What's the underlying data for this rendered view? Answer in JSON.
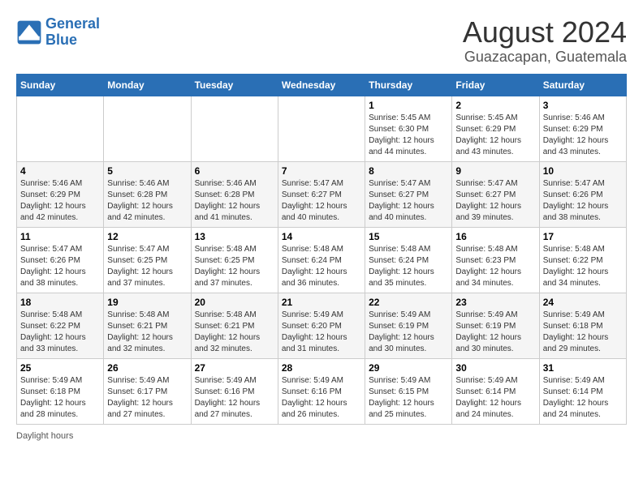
{
  "header": {
    "logo_line1": "General",
    "logo_line2": "Blue",
    "title": "August 2024",
    "subtitle": "Guazacapan, Guatemala"
  },
  "days_of_week": [
    "Sunday",
    "Monday",
    "Tuesday",
    "Wednesday",
    "Thursday",
    "Friday",
    "Saturday"
  ],
  "weeks": [
    [
      {
        "day": "",
        "sunrise": "",
        "sunset": "",
        "daylight": ""
      },
      {
        "day": "",
        "sunrise": "",
        "sunset": "",
        "daylight": ""
      },
      {
        "day": "",
        "sunrise": "",
        "sunset": "",
        "daylight": ""
      },
      {
        "day": "",
        "sunrise": "",
        "sunset": "",
        "daylight": ""
      },
      {
        "day": "1",
        "sunrise": "5:45 AM",
        "sunset": "6:30 PM",
        "daylight": "12 hours and 44 minutes."
      },
      {
        "day": "2",
        "sunrise": "5:45 AM",
        "sunset": "6:29 PM",
        "daylight": "12 hours and 43 minutes."
      },
      {
        "day": "3",
        "sunrise": "5:46 AM",
        "sunset": "6:29 PM",
        "daylight": "12 hours and 43 minutes."
      }
    ],
    [
      {
        "day": "4",
        "sunrise": "5:46 AM",
        "sunset": "6:29 PM",
        "daylight": "12 hours and 42 minutes."
      },
      {
        "day": "5",
        "sunrise": "5:46 AM",
        "sunset": "6:28 PM",
        "daylight": "12 hours and 42 minutes."
      },
      {
        "day": "6",
        "sunrise": "5:46 AM",
        "sunset": "6:28 PM",
        "daylight": "12 hours and 41 minutes."
      },
      {
        "day": "7",
        "sunrise": "5:47 AM",
        "sunset": "6:27 PM",
        "daylight": "12 hours and 40 minutes."
      },
      {
        "day": "8",
        "sunrise": "5:47 AM",
        "sunset": "6:27 PM",
        "daylight": "12 hours and 40 minutes."
      },
      {
        "day": "9",
        "sunrise": "5:47 AM",
        "sunset": "6:27 PM",
        "daylight": "12 hours and 39 minutes."
      },
      {
        "day": "10",
        "sunrise": "5:47 AM",
        "sunset": "6:26 PM",
        "daylight": "12 hours and 38 minutes."
      }
    ],
    [
      {
        "day": "11",
        "sunrise": "5:47 AM",
        "sunset": "6:26 PM",
        "daylight": "12 hours and 38 minutes."
      },
      {
        "day": "12",
        "sunrise": "5:47 AM",
        "sunset": "6:25 PM",
        "daylight": "12 hours and 37 minutes."
      },
      {
        "day": "13",
        "sunrise": "5:48 AM",
        "sunset": "6:25 PM",
        "daylight": "12 hours and 37 minutes."
      },
      {
        "day": "14",
        "sunrise": "5:48 AM",
        "sunset": "6:24 PM",
        "daylight": "12 hours and 36 minutes."
      },
      {
        "day": "15",
        "sunrise": "5:48 AM",
        "sunset": "6:24 PM",
        "daylight": "12 hours and 35 minutes."
      },
      {
        "day": "16",
        "sunrise": "5:48 AM",
        "sunset": "6:23 PM",
        "daylight": "12 hours and 34 minutes."
      },
      {
        "day": "17",
        "sunrise": "5:48 AM",
        "sunset": "6:22 PM",
        "daylight": "12 hours and 34 minutes."
      }
    ],
    [
      {
        "day": "18",
        "sunrise": "5:48 AM",
        "sunset": "6:22 PM",
        "daylight": "12 hours and 33 minutes."
      },
      {
        "day": "19",
        "sunrise": "5:48 AM",
        "sunset": "6:21 PM",
        "daylight": "12 hours and 32 minutes."
      },
      {
        "day": "20",
        "sunrise": "5:48 AM",
        "sunset": "6:21 PM",
        "daylight": "12 hours and 32 minutes."
      },
      {
        "day": "21",
        "sunrise": "5:49 AM",
        "sunset": "6:20 PM",
        "daylight": "12 hours and 31 minutes."
      },
      {
        "day": "22",
        "sunrise": "5:49 AM",
        "sunset": "6:19 PM",
        "daylight": "12 hours and 30 minutes."
      },
      {
        "day": "23",
        "sunrise": "5:49 AM",
        "sunset": "6:19 PM",
        "daylight": "12 hours and 30 minutes."
      },
      {
        "day": "24",
        "sunrise": "5:49 AM",
        "sunset": "6:18 PM",
        "daylight": "12 hours and 29 minutes."
      }
    ],
    [
      {
        "day": "25",
        "sunrise": "5:49 AM",
        "sunset": "6:18 PM",
        "daylight": "12 hours and 28 minutes."
      },
      {
        "day": "26",
        "sunrise": "5:49 AM",
        "sunset": "6:17 PM",
        "daylight": "12 hours and 27 minutes."
      },
      {
        "day": "27",
        "sunrise": "5:49 AM",
        "sunset": "6:16 PM",
        "daylight": "12 hours and 27 minutes."
      },
      {
        "day": "28",
        "sunrise": "5:49 AM",
        "sunset": "6:16 PM",
        "daylight": "12 hours and 26 minutes."
      },
      {
        "day": "29",
        "sunrise": "5:49 AM",
        "sunset": "6:15 PM",
        "daylight": "12 hours and 25 minutes."
      },
      {
        "day": "30",
        "sunrise": "5:49 AM",
        "sunset": "6:14 PM",
        "daylight": "12 hours and 24 minutes."
      },
      {
        "day": "31",
        "sunrise": "5:49 AM",
        "sunset": "6:14 PM",
        "daylight": "12 hours and 24 minutes."
      }
    ]
  ],
  "legend": {
    "daylight_label": "Daylight hours"
  }
}
